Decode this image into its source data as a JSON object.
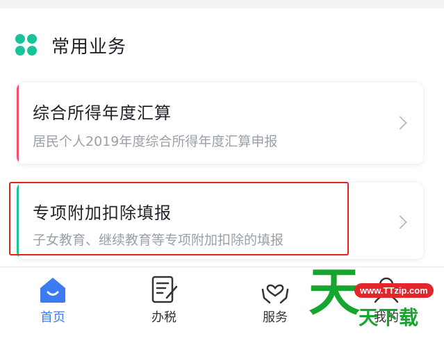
{
  "section": {
    "title": "常用业务",
    "icon": "four-dot-grid-icon"
  },
  "cards": [
    {
      "title": "综合所得年度汇算",
      "subtitle": "居民个人2019年度综合所得年度汇算申报",
      "accent": "#f0506e"
    },
    {
      "title": "专项附加扣除填报",
      "subtitle": "子女教育、继续教育等专项附加扣除的填报",
      "accent": "#19c39a"
    }
  ],
  "tabs": [
    {
      "label": "首页",
      "icon": "home-icon",
      "active": true
    },
    {
      "label": "办税",
      "icon": "document-edit-icon",
      "active": false
    },
    {
      "label": "服务",
      "icon": "heart-hands-icon",
      "active": false
    },
    {
      "label": "我的",
      "icon": "user-icon",
      "active": false
    }
  ],
  "watermark": {
    "big": "天",
    "url": "www.TTzip.com",
    "text": "天下载"
  },
  "colors": {
    "accent_green": "#19c39a",
    "active_blue": "#3b7cf5",
    "highlight_red": "#e0261c",
    "card1_accent": "#f0506e"
  }
}
